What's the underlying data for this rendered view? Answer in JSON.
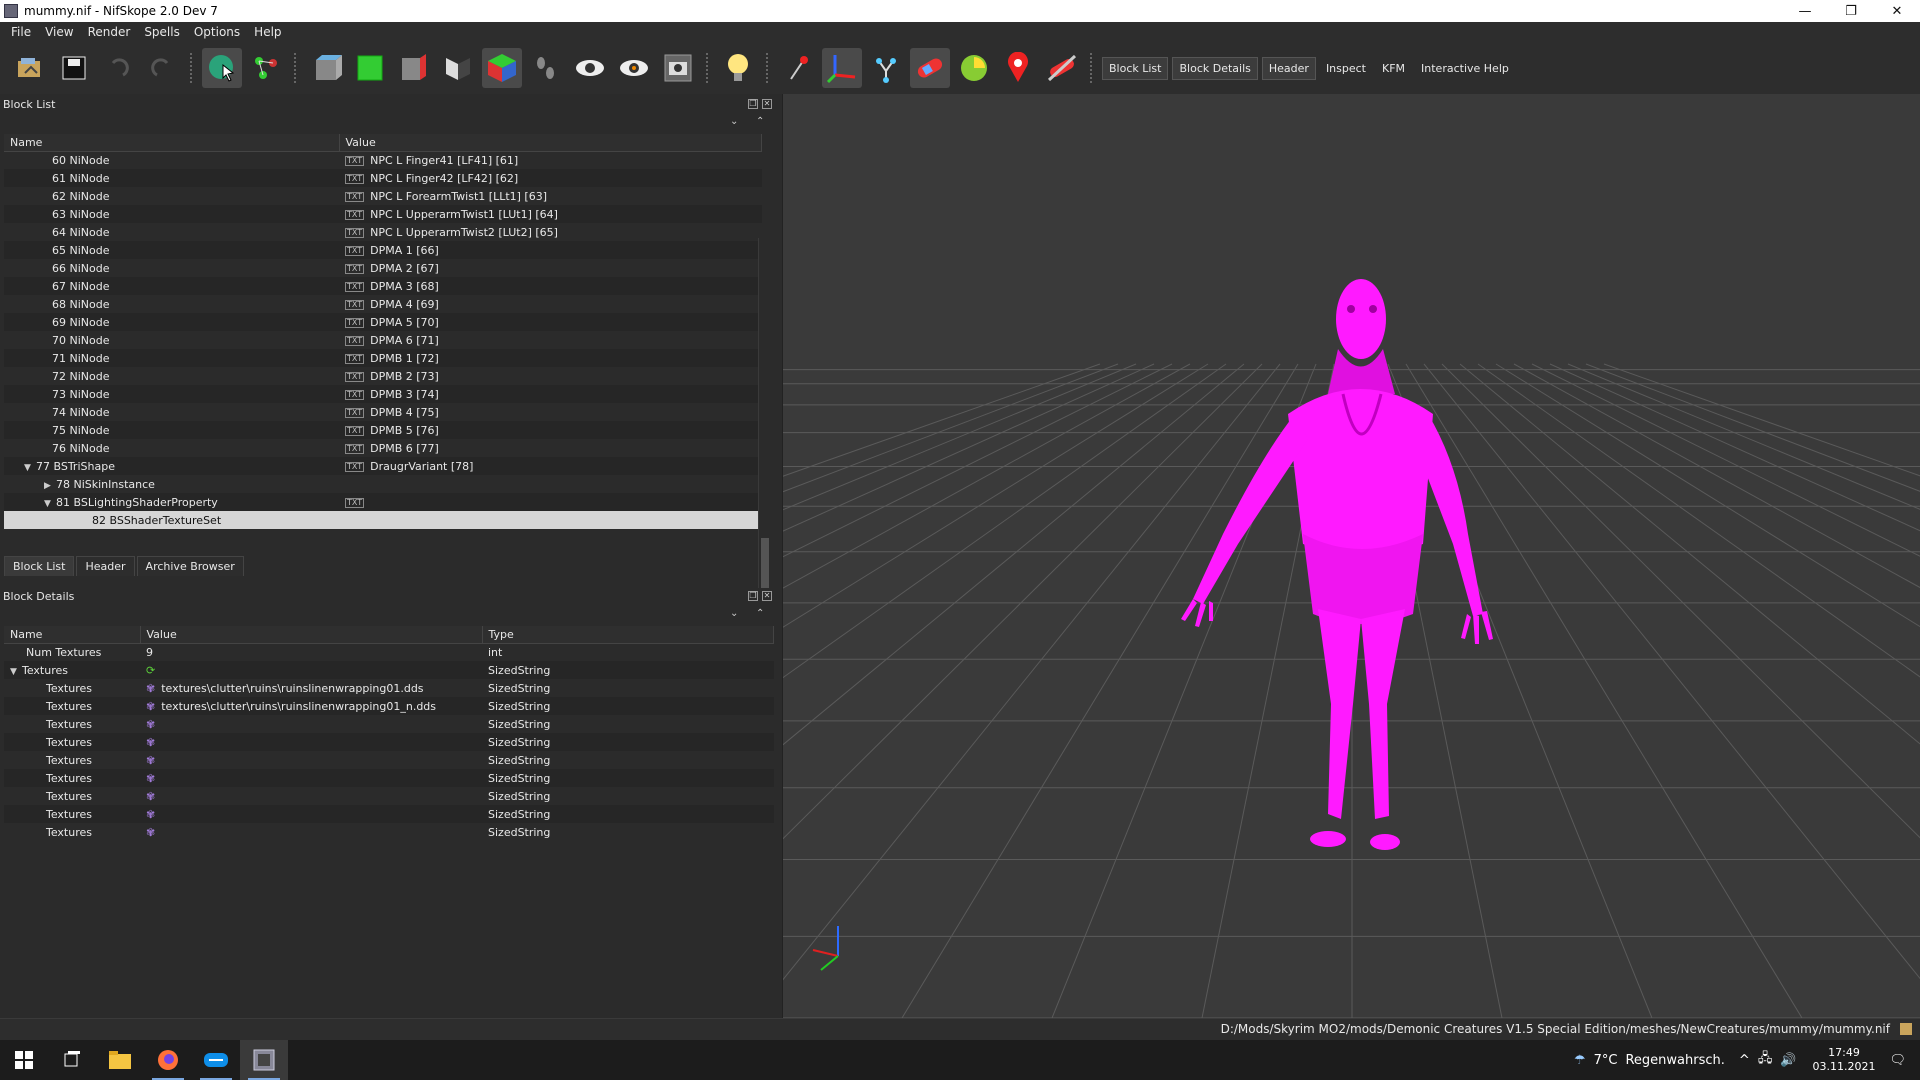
{
  "window": {
    "title": "mummy.nif - NifSkope 2.0 Dev 7",
    "controls": [
      "—",
      "❐",
      "✕"
    ]
  },
  "menu": [
    "File",
    "View",
    "Render",
    "Spells",
    "Options",
    "Help"
  ],
  "toolbar": {
    "icons": [
      "load-icon",
      "save-icon",
      "undo-icon",
      "redo-icon",
      "select-object-icon",
      "select-vertex-icon",
      "view-perspective-icon",
      "view-front-icon",
      "view-side-icon",
      "view-user-icon",
      "view-cube-icon",
      "walk-mode-icon",
      "show-hidden-icon",
      "show-nodes-icon",
      "screenshot-icon",
      "lighting-icon",
      "select-marker-icon",
      "axes-icon",
      "skeleton-icon",
      "draw-constraints-icon",
      "furniture-icon",
      "marker-icon",
      "hide-markers-icon"
    ],
    "panel_buttons": [
      "Block List",
      "Block Details",
      "Header",
      "Inspect",
      "KFM",
      "Interactive Help"
    ]
  },
  "block_list": {
    "title": "Block List",
    "columns": [
      "Name",
      "Value"
    ],
    "rows": [
      {
        "name": "60 NiNode",
        "value": "NPC L Finger41 [LF41] [61]"
      },
      {
        "name": "61 NiNode",
        "value": "NPC L Finger42 [LF42] [62]"
      },
      {
        "name": "62 NiNode",
        "value": "NPC L ForearmTwist1 [LLt1] [63]"
      },
      {
        "name": "63 NiNode",
        "value": "NPC L UpperarmTwist1 [LUt1] [64]"
      },
      {
        "name": "64 NiNode",
        "value": "NPC L UpperarmTwist2 [LUt2] [65]"
      },
      {
        "name": "65 NiNode",
        "value": "DPMA 1 [66]"
      },
      {
        "name": "66 NiNode",
        "value": "DPMA 2 [67]"
      },
      {
        "name": "67 NiNode",
        "value": "DPMA 3 [68]"
      },
      {
        "name": "68 NiNode",
        "value": "DPMA 4 [69]"
      },
      {
        "name": "69 NiNode",
        "value": "DPMA 5 [70]"
      },
      {
        "name": "70 NiNode",
        "value": "DPMA 6 [71]"
      },
      {
        "name": "71 NiNode",
        "value": "DPMB 1 [72]"
      },
      {
        "name": "72 NiNode",
        "value": "DPMB 2 [73]"
      },
      {
        "name": "73 NiNode",
        "value": "DPMB 3 [74]"
      },
      {
        "name": "74 NiNode",
        "value": "DPMB 4 [75]"
      },
      {
        "name": "75 NiNode",
        "value": "DPMB 5 [76]"
      },
      {
        "name": "76 NiNode",
        "value": "DPMB 6 [77]"
      },
      {
        "name": "77 BSTriShape",
        "value": "DraugrVariant [78]"
      },
      {
        "name": "78 NiSkinInstance",
        "value": ""
      },
      {
        "name": "81 BSLightingShaderProperty",
        "value": ""
      },
      {
        "name": "82 BSShaderTextureSet",
        "value": ""
      }
    ],
    "tabs": [
      "Block List",
      "Header",
      "Archive Browser"
    ]
  },
  "block_details": {
    "title": "Block Details",
    "columns": [
      "Name",
      "Value",
      "Type"
    ],
    "num_textures": {
      "name": "Num Textures",
      "value": "9",
      "type": "int"
    },
    "textures_group": {
      "name": "Textures",
      "type": "SizedString"
    },
    "textures": [
      {
        "name": "Textures",
        "value": "textures\\clutter\\ruins\\ruinslinenwrapping01.dds",
        "type": "SizedString"
      },
      {
        "name": "Textures",
        "value": "textures\\clutter\\ruins\\ruinslinenwrapping01_n.dds",
        "type": "SizedString"
      },
      {
        "name": "Textures",
        "value": "",
        "type": "SizedString"
      },
      {
        "name": "Textures",
        "value": "",
        "type": "SizedString"
      },
      {
        "name": "Textures",
        "value": "",
        "type": "SizedString"
      },
      {
        "name": "Textures",
        "value": "",
        "type": "SizedString"
      },
      {
        "name": "Textures",
        "value": "",
        "type": "SizedString"
      },
      {
        "name": "Textures",
        "value": "",
        "type": "SizedString"
      },
      {
        "name": "Textures",
        "value": "",
        "type": "SizedString"
      }
    ]
  },
  "status": {
    "path": "D:/Mods/Skyrim MO2/mods/Demonic Creatures V1.5 Special Edition/meshes/NewCreatures/mummy/mummy.nif"
  },
  "taskbar": {
    "apps": [
      "windows-start-icon",
      "task-view-icon",
      "file-explorer-icon",
      "firefox-icon",
      "teamviewer-icon",
      "nifskope-icon"
    ],
    "temperature": "7°C",
    "weather": "Regenwahrsch.",
    "time": "17:49",
    "date": "03.11.2021"
  },
  "colors": {
    "model_magenta": "#ff1aff",
    "viewport_bg": "#3a3a3a",
    "selection": "#d6d6d6"
  }
}
